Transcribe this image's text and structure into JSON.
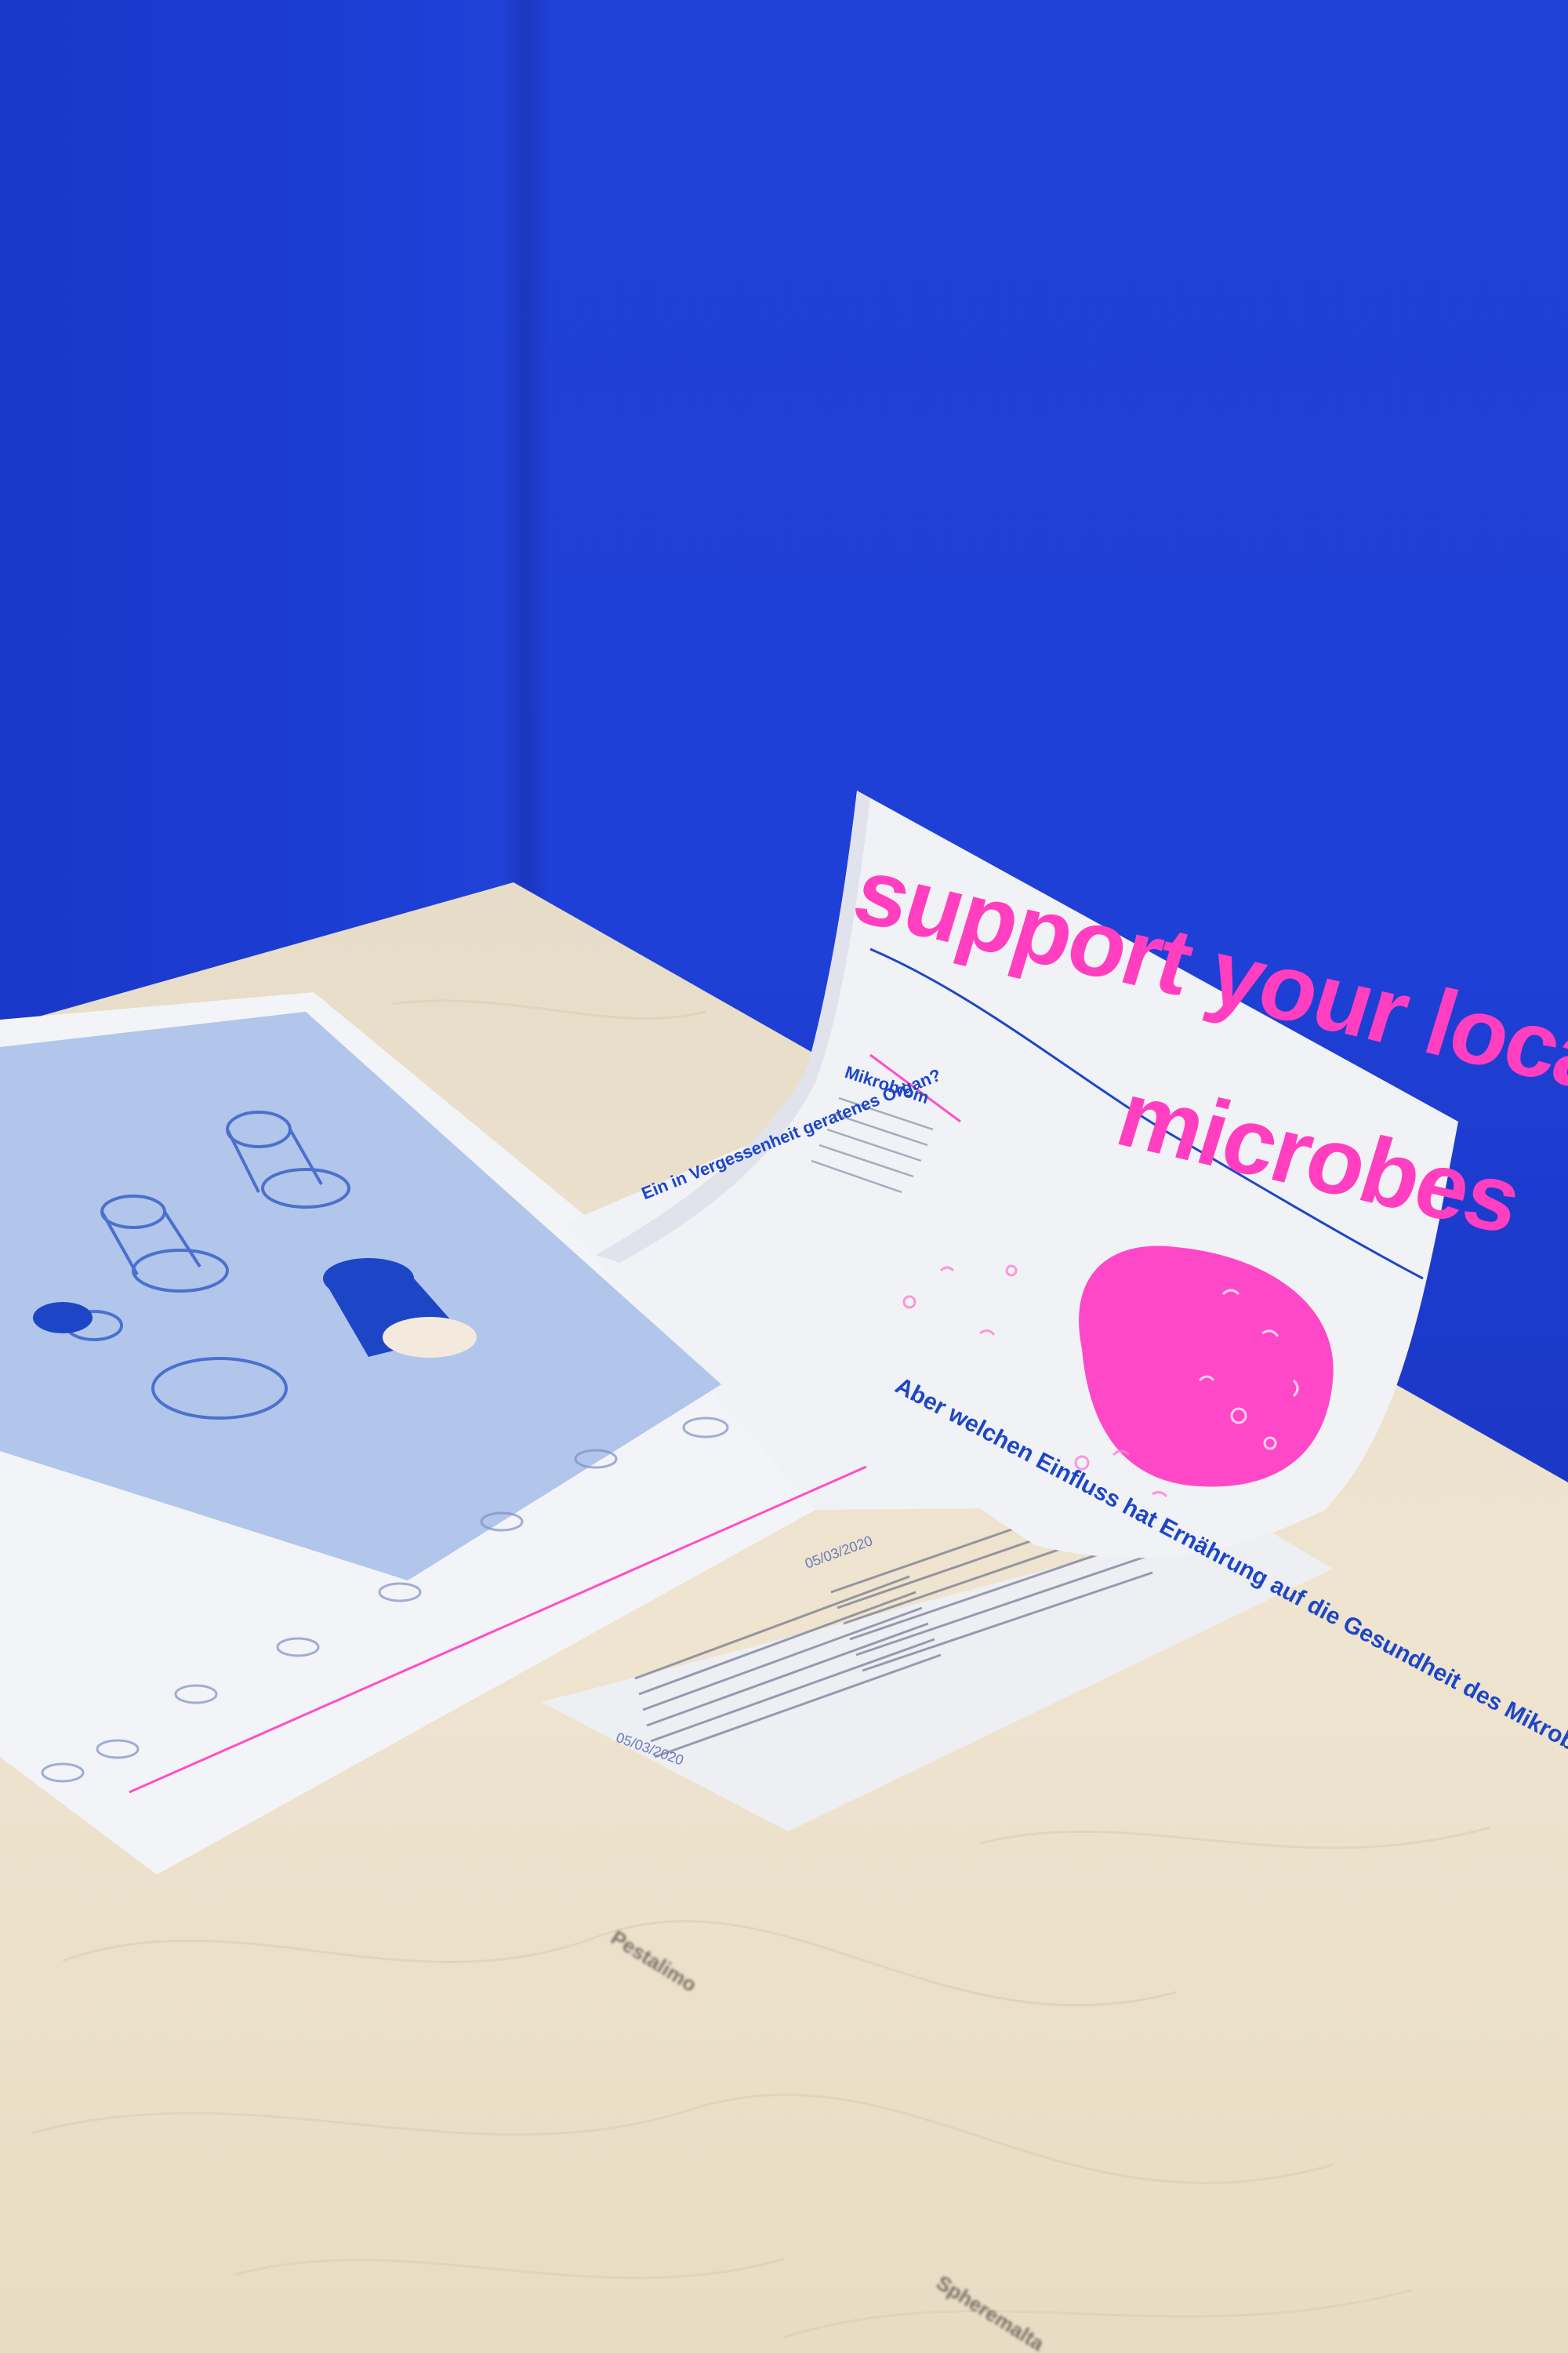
{
  "scene": {
    "description_colors": {
      "wall": "#1f3fd6",
      "table": "#eee3cf",
      "paper": "#f2f3f6",
      "neon_pink": "#ff3fc0",
      "print_blue": "#1d46c7"
    }
  },
  "poster": {
    "headline_line1": "support your local",
    "headline_line2": "microbes",
    "section_heading": "Mikrobiom"
  },
  "spread": {
    "heading_organ": "Ein in Vergessenheit geratenes Organ?",
    "heading_einfluss": "Aber welchen Einfluss hat Ernährung auf die Gesundheit des Mikrobioms Mensch?",
    "date": "05/03/2020"
  },
  "second_sheet": {
    "date": "05/03/2020"
  },
  "table_imprint": {
    "line1": "Pestalimo",
    "line2": "Spheremalta"
  }
}
